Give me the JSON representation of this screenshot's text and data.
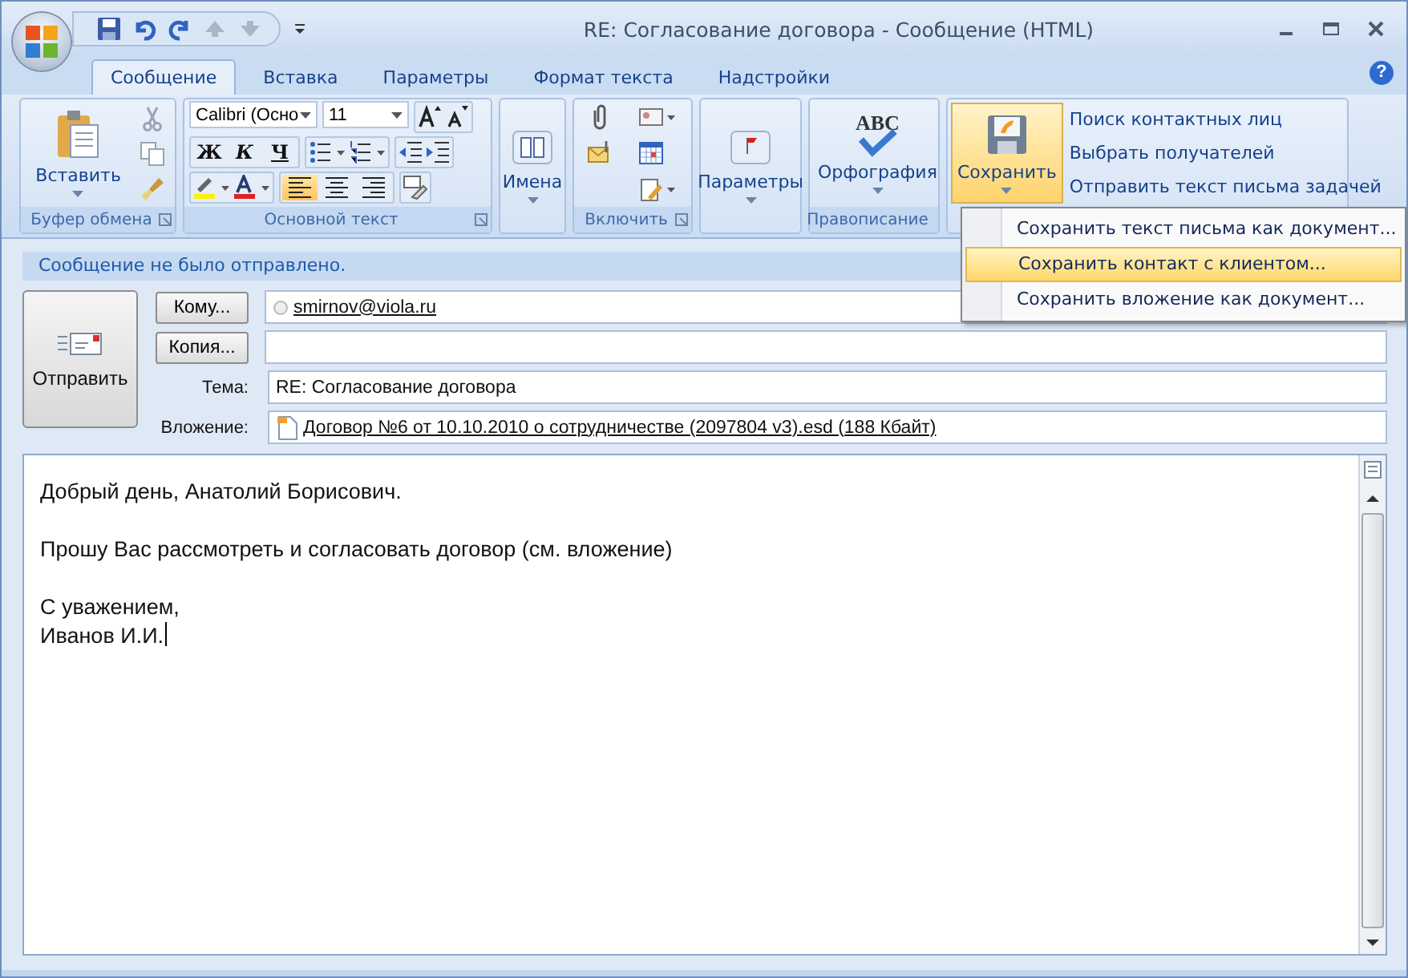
{
  "window": {
    "title": "RE: Согласование договора - Сообщение (HTML)"
  },
  "tabs": [
    {
      "label": "Сообщение",
      "selected": true
    },
    {
      "label": "Вставка",
      "selected": false
    },
    {
      "label": "Параметры",
      "selected": false
    },
    {
      "label": "Формат текста",
      "selected": false
    },
    {
      "label": "Надстройки",
      "selected": false
    }
  ],
  "help": "?",
  "ribbon": {
    "clipboard": {
      "label": "Буфер обмена",
      "paste": "Вставить"
    },
    "basic_text": {
      "label": "Основной текст",
      "font": "Calibri (Осно",
      "size": "11",
      "style_buttons": [
        {
          "label": "Ж",
          "kind": "bold"
        },
        {
          "label": "К",
          "kind": "italic"
        },
        {
          "label": "Ч",
          "kind": "underline"
        }
      ],
      "align": [
        {
          "kind": "left",
          "selected": true
        },
        {
          "kind": "center",
          "selected": false
        },
        {
          "kind": "right",
          "selected": false
        }
      ]
    },
    "names": {
      "button": "Имена"
    },
    "include": {
      "label": "Включить"
    },
    "options": {
      "button": "Параметры"
    },
    "proofing": {
      "label": "Правописание",
      "button": "Орфография",
      "icon_text": "ABC"
    },
    "save": {
      "button": "Сохранить",
      "expanded": true,
      "links": [
        "Поиск контактных лиц",
        "Выбрать получателей",
        "Отправить текст письма задачей"
      ]
    }
  },
  "menu": {
    "items": [
      {
        "label": "Сохранить текст письма как документ...",
        "selected": false
      },
      {
        "label": "Сохранить контакт с клиентом...",
        "selected": true
      },
      {
        "label": "Сохранить вложение как документ...",
        "selected": false
      }
    ]
  },
  "info_bar": "Сообщение не было отправлено.",
  "send_button": "Отправить",
  "to": {
    "button": "Кому...",
    "value": "smirnov@viola.ru"
  },
  "cc": {
    "button": "Копия..."
  },
  "subject": {
    "label": "Тема:",
    "value": "RE: Согласование договора"
  },
  "attachment": {
    "label": "Вложение:",
    "file": "Договор №6  от 10.10.2010 о сотрудничестве (2097804 v3).esd (188 Кбайт)"
  },
  "body": {
    "paragraphs": [
      [
        "Добрый день, Анатолий Борисович."
      ],
      [
        "Прошу Вас рассмотреть и согласовать договор (см. вложение)"
      ],
      [
        "С уважением,",
        "Иванов И.И."
      ]
    ]
  }
}
